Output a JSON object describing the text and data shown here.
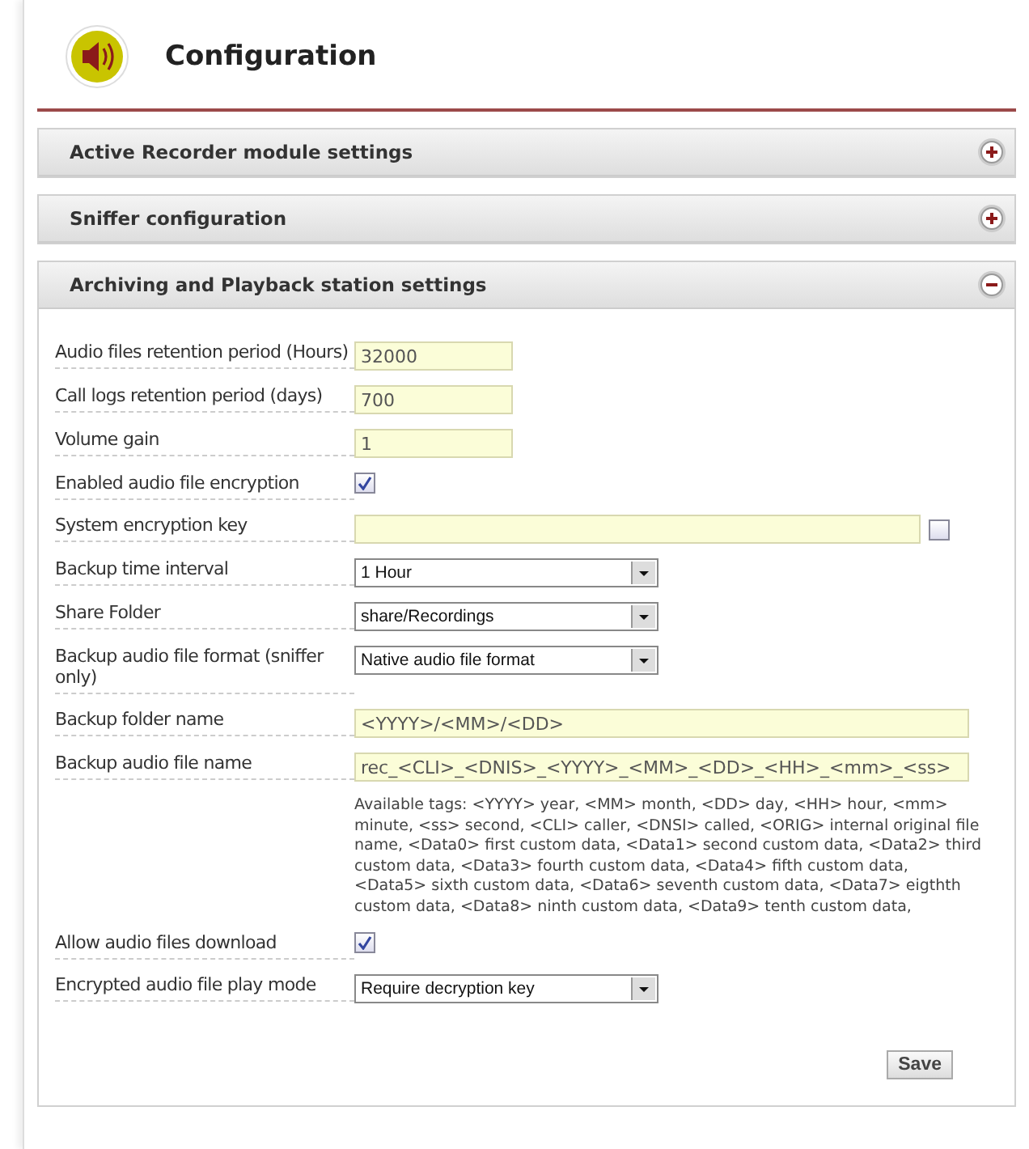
{
  "page": {
    "title": "Configuration"
  },
  "panels": [
    {
      "title": "Active Recorder module settings",
      "expanded": false
    },
    {
      "title": "Sniffer configuration",
      "expanded": false
    },
    {
      "title": "Archiving and Playback station settings",
      "expanded": true,
      "fields": [
        {
          "kind": "text",
          "label": "Audio files retention period (Hours)",
          "value": "32000"
        },
        {
          "kind": "text",
          "label": "Call logs retention period (days)",
          "value": "700"
        },
        {
          "kind": "text",
          "label": "Volume gain",
          "value": "1"
        },
        {
          "kind": "checkbox",
          "label": "Enabled audio file encryption",
          "checked": true
        },
        {
          "kind": "key",
          "label": "System encryption key",
          "checked": false
        },
        {
          "kind": "select",
          "label": "Backup time interval",
          "value": "1 Hour"
        },
        {
          "kind": "select",
          "label": "Share Folder",
          "value": "share/Recordings"
        },
        {
          "kind": "select",
          "label": "Backup audio file format (sniffer only)",
          "value": "Native audio file format"
        },
        {
          "kind": "wide",
          "label": "Backup folder name",
          "value": "<YYYY>/<MM>/<DD>"
        },
        {
          "kind": "wide",
          "label": "Backup audio file name",
          "value": "rec_<CLI>_<DNIS>_<YYYY>_<MM>_<DD>_<HH>_<mm>_<ss>"
        },
        {
          "kind": "note",
          "text": "Available tags: <YYYY> year, <MM> month, <DD> day, <HH> hour, <mm> minute, <ss> second, <CLI> caller, <DNSI> called, <ORIG> internal original file name, <Data0> first custom data, <Data1> second custom data, <Data2> third custom data, <Data3> fourth custom data, <Data4> fifth custom data, <Data5> sixth custom data, <Data6> seventh custom data, <Data7> eigthth custom data, <Data8> ninth custom data, <Data9> tenth custom data,"
        },
        {
          "kind": "checkbox",
          "label": "Allow audio files download",
          "checked": true
        },
        {
          "kind": "select",
          "label": "Encrypted audio file play mode",
          "value": "Require decryption key"
        }
      ],
      "save_button": "Save"
    }
  ]
}
